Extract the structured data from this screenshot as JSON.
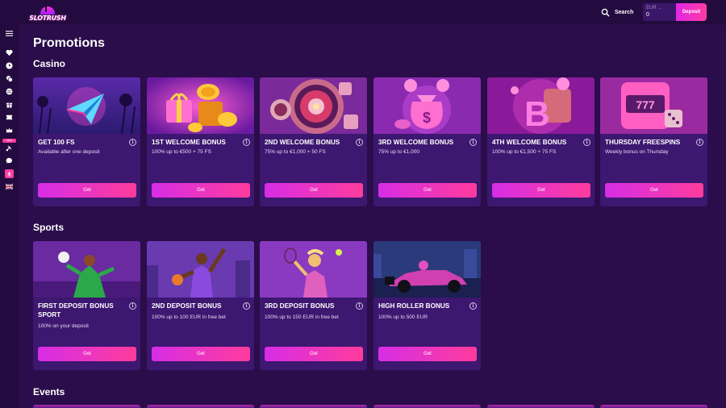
{
  "header": {
    "logo_text": "SLOTRUSH",
    "search_label": "Search",
    "wallet": {
      "currency": "EUR",
      "amount": "0"
    },
    "deposit_label": "Deposit"
  },
  "sidebar": {
    "items": [
      {
        "icon": "menu-icon"
      },
      {
        "icon": "heart-icon"
      },
      {
        "icon": "clock-icon"
      },
      {
        "icon": "chips-icon"
      },
      {
        "icon": "ball-icon"
      },
      {
        "icon": "gift-icon"
      },
      {
        "icon": "ticket-icon"
      },
      {
        "icon": "crown-icon"
      },
      {
        "icon": "satellite-icon",
        "badge": "NEW"
      },
      {
        "icon": "chat-icon"
      },
      {
        "icon": "download-icon"
      },
      {
        "icon": "uk-flag-icon"
      }
    ]
  },
  "page": {
    "title": "Promotions",
    "sections": {
      "casino": "Casino",
      "sports": "Sports",
      "events": "Events"
    }
  },
  "casino_cards": [
    {
      "title": "GET 100 FS",
      "desc": "Available after one deposit",
      "button": "Get",
      "art": "paper-plane"
    },
    {
      "title": "1ST WELCOME BONUS",
      "desc": "100% up to €500 + 75 FS",
      "button": "Get",
      "art": "gift-coins"
    },
    {
      "title": "2ND WELCOME BONUS",
      "desc": "75% up to €1,000 + 50 FS",
      "button": "Get",
      "art": "roulette"
    },
    {
      "title": "3RD WELCOME BONUS",
      "desc": "75% up to €1,000",
      "button": "Get",
      "art": "money-bag"
    },
    {
      "title": "4TH WELCOME BONUS",
      "desc": "100% up to €1,500 + 75 FS",
      "button": "Get",
      "art": "bitcoin"
    },
    {
      "title": "THURSDAY FREESPINS",
      "desc": "Weekly bonus on Thursday",
      "button": "Get",
      "art": "slot-machine"
    }
  ],
  "sports_cards": [
    {
      "title": "FIRST DEPOSIT BONUS SPORT",
      "desc": "100% on your deposit",
      "button": "Get",
      "art": "soccer"
    },
    {
      "title": "2ND DEPOSIT BONUS",
      "desc": "100% up to 100 EUR in free bet",
      "button": "Get",
      "art": "basketball"
    },
    {
      "title": "3RD DEPOSIT BONUS",
      "desc": "100% up to 150 EUR in free bet",
      "button": "Get",
      "art": "tennis"
    },
    {
      "title": "HIGH ROLLER BONUS",
      "desc": "100% up to 500 EUR",
      "button": "Get",
      "art": "formula-car"
    }
  ],
  "colors": {
    "background": "#2a0d4a",
    "card": "#3d1770",
    "accent_start": "#d62de6",
    "accent_end": "#ff3c9c"
  }
}
